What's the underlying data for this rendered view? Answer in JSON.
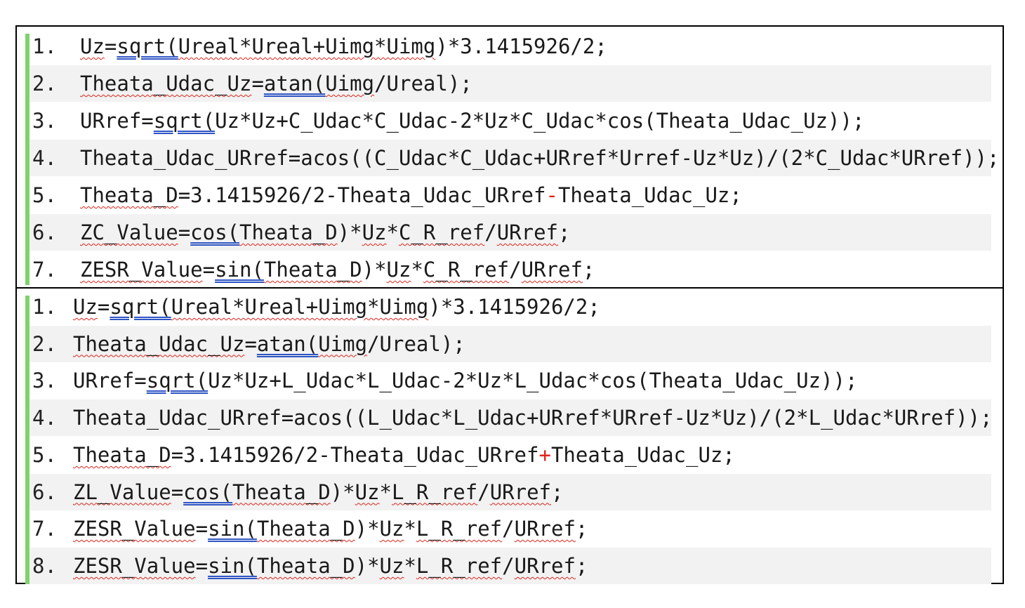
{
  "block1": {
    "lines": [
      {
        "n": "1.",
        "parts": [
          {
            "t": "Uz",
            "s": "wavy"
          },
          {
            "t": "="
          },
          {
            "t": "sqrt(",
            "s": "dbl"
          },
          {
            "t": "Ureal*Ureal+Uimg*Uimg",
            "s": "wavy"
          },
          {
            "t": ")*3.1415926/2;"
          }
        ]
      },
      {
        "n": "2.",
        "parts": [
          {
            "t": "Theata_Udac_Uz",
            "s": "wavy"
          },
          {
            "t": "="
          },
          {
            "t": "atan(",
            "s": "dbl"
          },
          {
            "t": "Uimg",
            "s": "wavy"
          },
          {
            "t": "/Ureal);"
          }
        ]
      },
      {
        "n": "3.",
        "parts": [
          {
            "t": "URref="
          },
          {
            "t": "sqrt(",
            "s": "dbl"
          },
          {
            "t": "Uz*Uz+C_Udac*C_Udac-2*Uz*C_Udac*cos(Theata_Udac_Uz));"
          }
        ]
      },
      {
        "n": "4.",
        "parts": [
          {
            "t": "Theata_Udac_URref=acos((C_Udac*C_Udac+URref*Urref-Uz*Uz)/(2*C_Udac*URref));"
          }
        ]
      },
      {
        "n": "5.",
        "parts": [
          {
            "t": "Theata_D",
            "s": "wavy"
          },
          {
            "t": "=3.1415926/2-Theata_Udac_URref"
          },
          {
            "t": "-",
            "s": "red"
          },
          {
            "t": "Theata_Udac_Uz;"
          }
        ]
      },
      {
        "n": "6.",
        "parts": [
          {
            "t": "ZC_Value",
            "s": "wavy"
          },
          {
            "t": "="
          },
          {
            "t": "cos(",
            "s": "dbl"
          },
          {
            "t": "Theata_D",
            "s": "wavy"
          },
          {
            "t": ")*"
          },
          {
            "t": "Uz",
            "s": "wavy"
          },
          {
            "t": "*"
          },
          {
            "t": "C_R_ref",
            "s": "wavy"
          },
          {
            "t": "/"
          },
          {
            "t": "URref",
            "s": "wavy"
          },
          {
            "t": ";"
          }
        ]
      },
      {
        "n": "7.",
        "parts": [
          {
            "t": "ZESR_Value",
            "s": "wavy"
          },
          {
            "t": "="
          },
          {
            "t": "sin(",
            "s": "dbl"
          },
          {
            "t": "Theata_D",
            "s": "wavy"
          },
          {
            "t": ")*"
          },
          {
            "t": "Uz",
            "s": "wavy"
          },
          {
            "t": "*"
          },
          {
            "t": "C_R_ref",
            "s": "wavy"
          },
          {
            "t": "/"
          },
          {
            "t": "URref",
            "s": "wavy"
          },
          {
            "t": ";"
          }
        ]
      }
    ]
  },
  "block2": {
    "lines": [
      {
        "n": "1.",
        "parts": [
          {
            "t": "Uz",
            "s": "wavy"
          },
          {
            "t": "="
          },
          {
            "t": "sqrt(",
            "s": "dbl"
          },
          {
            "t": "Ureal*Ureal+Uimg*Uimg",
            "s": "wavy"
          },
          {
            "t": ")*3.1415926/2;"
          }
        ]
      },
      {
        "n": "2.",
        "parts": [
          {
            "t": "Theata_Udac_Uz",
            "s": "wavy"
          },
          {
            "t": "="
          },
          {
            "t": "atan(",
            "s": "dbl"
          },
          {
            "t": "Uimg",
            "s": "wavy"
          },
          {
            "t": "/Ureal);"
          }
        ]
      },
      {
        "n": "3.",
        "parts": [
          {
            "t": "URref="
          },
          {
            "t": "sqrt(",
            "s": "dbl"
          },
          {
            "t": "Uz*Uz+L_Udac*L_Udac-2*Uz*L_Udac*cos(Theata_Udac_Uz));"
          }
        ]
      },
      {
        "n": "4.",
        "parts": [
          {
            "t": "Theata_Udac_URref=acos((L_Udac*L_Udac+URref*URref-Uz*Uz)/(2*L_Udac*URref));"
          }
        ]
      },
      {
        "n": "5.",
        "parts": [
          {
            "t": "Theata_D",
            "s": "wavy"
          },
          {
            "t": "=3.1415926/2-Theata_Udac_URref"
          },
          {
            "t": "+",
            "s": "red"
          },
          {
            "t": "Theata_Udac_Uz;"
          }
        ]
      },
      {
        "n": "6.",
        "parts": [
          {
            "t": "ZL_Value",
            "s": "wavy"
          },
          {
            "t": "="
          },
          {
            "t": "cos(",
            "s": "dbl"
          },
          {
            "t": "Theata_D",
            "s": "wavy"
          },
          {
            "t": ")*"
          },
          {
            "t": "Uz",
            "s": "wavy"
          },
          {
            "t": "*"
          },
          {
            "t": "L_R_ref",
            "s": "wavy"
          },
          {
            "t": "/"
          },
          {
            "t": "URref",
            "s": "wavy"
          },
          {
            "t": ";"
          }
        ]
      },
      {
        "n": "7.",
        "parts": [
          {
            "t": "ZESR_Value",
            "s": "wavy"
          },
          {
            "t": "="
          },
          {
            "t": "sin(",
            "s": "dbl"
          },
          {
            "t": "Theata_D",
            "s": "wavy"
          },
          {
            "t": ")*"
          },
          {
            "t": "Uz",
            "s": "wavy"
          },
          {
            "t": "*"
          },
          {
            "t": "L_R_ref",
            "s": "wavy"
          },
          {
            "t": "/"
          },
          {
            "t": "URref",
            "s": "wavy"
          },
          {
            "t": ";"
          }
        ]
      },
      {
        "n": "8.",
        "parts": [
          {
            "t": "ZESR_Value",
            "s": "wavy"
          },
          {
            "t": "="
          },
          {
            "t": "sin(",
            "s": "dbl"
          },
          {
            "t": "Theata_D",
            "s": "wavy"
          },
          {
            "t": ")*"
          },
          {
            "t": "Uz",
            "s": "wavy"
          },
          {
            "t": "*"
          },
          {
            "t": "L_R_ref",
            "s": "wavy"
          },
          {
            "t": "/"
          },
          {
            "t": "URref",
            "s": "wavy"
          },
          {
            "t": ";"
          }
        ]
      }
    ]
  },
  "colors": {
    "line_bar": "#7ed36b",
    "stripe": "#f2f2f2",
    "spell_underline": "#e0241b",
    "grammar_underline": "#2f55c4",
    "highlight_operator": "#e0241b"
  }
}
